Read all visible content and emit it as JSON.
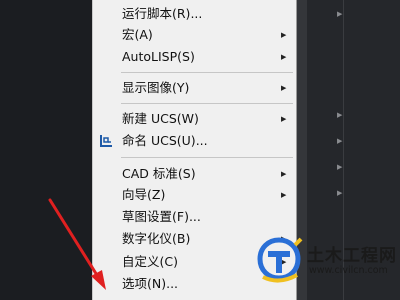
{
  "menu": {
    "items": [
      {
        "label": "运行脚本(R)...",
        "submenu": false
      },
      {
        "label": "宏(A)",
        "submenu": true
      },
      {
        "label": "AutoLISP(S)",
        "submenu": true
      },
      {
        "label": "显示图像(Y)",
        "submenu": true
      },
      {
        "label": "新建 UCS(W)",
        "submenu": true
      },
      {
        "label": "命名 UCS(U)...",
        "submenu": false,
        "icon": "named-ucs-icon"
      },
      {
        "label": "CAD 标准(S)",
        "submenu": true
      },
      {
        "label": "向导(Z)",
        "submenu": true
      },
      {
        "label": "草图设置(F)...",
        "submenu": false
      },
      {
        "label": "数字化仪(B)",
        "submenu": true
      },
      {
        "label": "自定义(C)",
        "submenu": true
      },
      {
        "label": "选项(N)...",
        "submenu": false
      }
    ]
  },
  "watermark": {
    "title": "土木工程网",
    "url": "www.civilcn.com"
  },
  "colors": {
    "menu_bg": "#f0f0f0",
    "arrow": "#e02020",
    "logo_blue": "#2a6fd6",
    "logo_yellow": "#f0c020"
  }
}
